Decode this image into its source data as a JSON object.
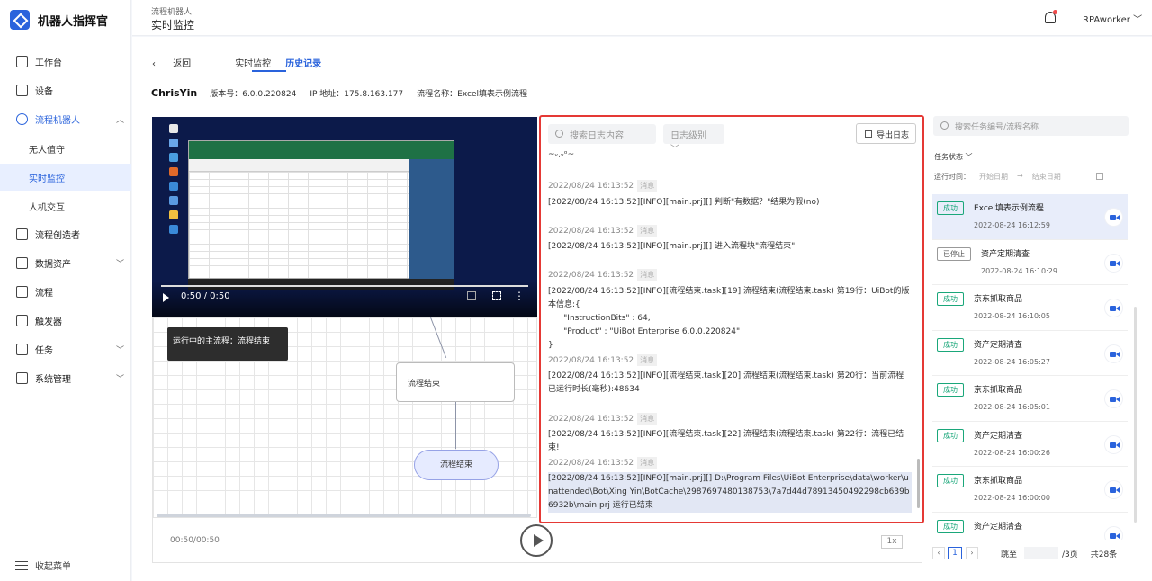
{
  "app": {
    "name": "机器人指挥官"
  },
  "sidebar": {
    "items": [
      {
        "label": "工作台",
        "icon": "monitor-icon"
      },
      {
        "label": "设备",
        "icon": "device-icon"
      },
      {
        "label": "流程机器人",
        "icon": "robot-icon",
        "expanded": true
      },
      {
        "label": "流程创造者",
        "icon": "terminal-icon"
      },
      {
        "label": "数据资产",
        "icon": "folder-icon"
      },
      {
        "label": "流程",
        "icon": "flow-icon"
      },
      {
        "label": "触发器",
        "icon": "trigger-icon"
      },
      {
        "label": "任务",
        "icon": "task-icon"
      },
      {
        "label": "系统管理",
        "icon": "settings-icon"
      }
    ],
    "subitems": [
      {
        "label": "无人值守"
      },
      {
        "label": "实时监控",
        "active": true
      },
      {
        "label": "人机交互"
      }
    ],
    "collapse_label": "收起菜单"
  },
  "header": {
    "breadcrumb": "流程机器人",
    "title": "实时监控",
    "user": "RPAworker"
  },
  "tabs": {
    "back": "返回",
    "live": "实时监控",
    "history": "历史记录"
  },
  "info": {
    "username": "ChrisYin",
    "version": "版本号：6.0.0.220824",
    "ip": "IP 地址：175.8.163.177",
    "flow_name": "流程名称：Excel填表示例流程"
  },
  "video": {
    "time": "0:50 / 0:50"
  },
  "flow": {
    "tip": "运行中的主流程：流程结束",
    "node": "流程结束",
    "end_node": "流程结束"
  },
  "player": {
    "time": "00:50/00:50",
    "speed": "1x"
  },
  "log": {
    "search_placeholder": "搜索日志内容",
    "level_placeholder": "日志级别",
    "export_label": "导出日志",
    "top_fragment": "~ᵥ,ᵥᵒ~",
    "tag": "消息",
    "entries": [
      {
        "ts": "2022/08/24 16:13:52",
        "msg": "[2022/08/24 16:13:52][INFO][main.prj][] 判断\"有数据？\"结果为假(no)"
      },
      {
        "ts": "2022/08/24 16:13:52",
        "msg": "[2022/08/24 16:13:52][INFO][main.prj][] 进入流程块\"流程结束\""
      },
      {
        "ts": "2022/08/24 16:13:52",
        "msg": "[2022/08/24 16:13:52][INFO][流程结束.task][19] 流程结束(流程结束.task) 第19行：UiBot的版本信息:{\n      \"InstructionBits\" : 64,\n      \"Product\" : \"UiBot Enterprise 6.0.0.220824\"\n}"
      },
      {
        "ts": "2022/08/24 16:13:52",
        "msg": "[2022/08/24 16:13:52][INFO][流程结束.task][20] 流程结束(流程结束.task) 第20行：当前流程已运行时长(毫秒):48634"
      },
      {
        "ts": "2022/08/24 16:13:52",
        "msg": "[2022/08/24 16:13:52][INFO][流程结束.task][22] 流程结束(流程结束.task) 第22行：流程已结束!"
      },
      {
        "ts": "2022/08/24 16:13:52",
        "msg": "[2022/08/24 16:13:52][INFO][main.prj][] D:\\Program Files\\UiBot Enterprise\\data\\worker\\unattended\\Bot\\Xing Yin\\BotCache\\2987697480138753\\7a7d44d78913450492298cb639b6932b\\main.prj 运行已结束"
      }
    ]
  },
  "records": {
    "search_placeholder": "搜索任务编号/流程名称",
    "status_label": "任务状态",
    "time_label": "运行时间：",
    "start_placeholder": "开始日期",
    "end_placeholder": "结束日期",
    "items": [
      {
        "status": "成功",
        "name": "Excel填表示例流程",
        "date": "2022-08-24 16:12:59"
      },
      {
        "status": "已停止",
        "name": "资产定期清查",
        "date": "2022-08-24 16:10:29"
      },
      {
        "status": "成功",
        "name": "京东抓取商品",
        "date": "2022-08-24 16:10:05"
      },
      {
        "status": "成功",
        "name": "资产定期清查",
        "date": "2022-08-24 16:05:27"
      },
      {
        "status": "成功",
        "name": "京东抓取商品",
        "date": "2022-08-24 16:05:01"
      },
      {
        "status": "成功",
        "name": "资产定期清查",
        "date": "2022-08-24 16:00:26"
      },
      {
        "status": "成功",
        "name": "京东抓取商品",
        "date": "2022-08-24 16:00:00"
      },
      {
        "status": "成功",
        "name": "资产定期清查",
        "date": ""
      }
    ],
    "pager": {
      "current": "1",
      "jump_label": "跳至",
      "pages": "/3页",
      "total": "共28条"
    }
  },
  "colors": {
    "accent": "#2a63dc",
    "success": "#1aa77a",
    "highlight_border": "#e53935"
  }
}
